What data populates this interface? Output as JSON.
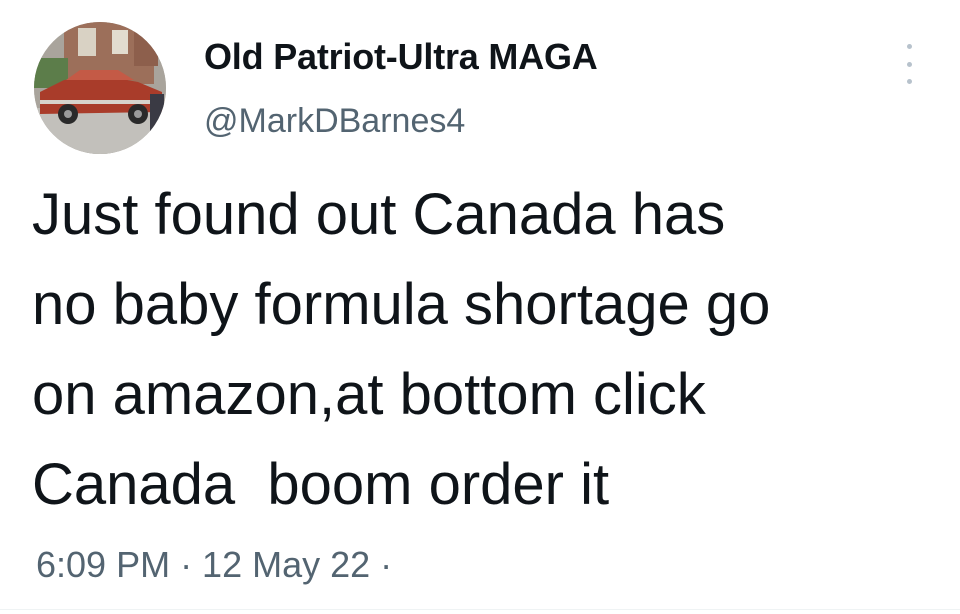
{
  "tweet": {
    "display_name": "Old Patriot-Ultra MAGA",
    "handle": "@MarkDBarnes4",
    "text": "Just found out Canada has\nno baby formula shortage go\non amazon,at bottom click\nCanada  boom order it",
    "meta": "6:09 PM · 12 May 22 ·",
    "avatar_icon": "profile-photo-classic-car",
    "more_icon": "more-vertical-icon"
  },
  "colors": {
    "text_primary": "#0f1419",
    "text_secondary": "#536471",
    "more_dots": "#b7c2cc"
  }
}
